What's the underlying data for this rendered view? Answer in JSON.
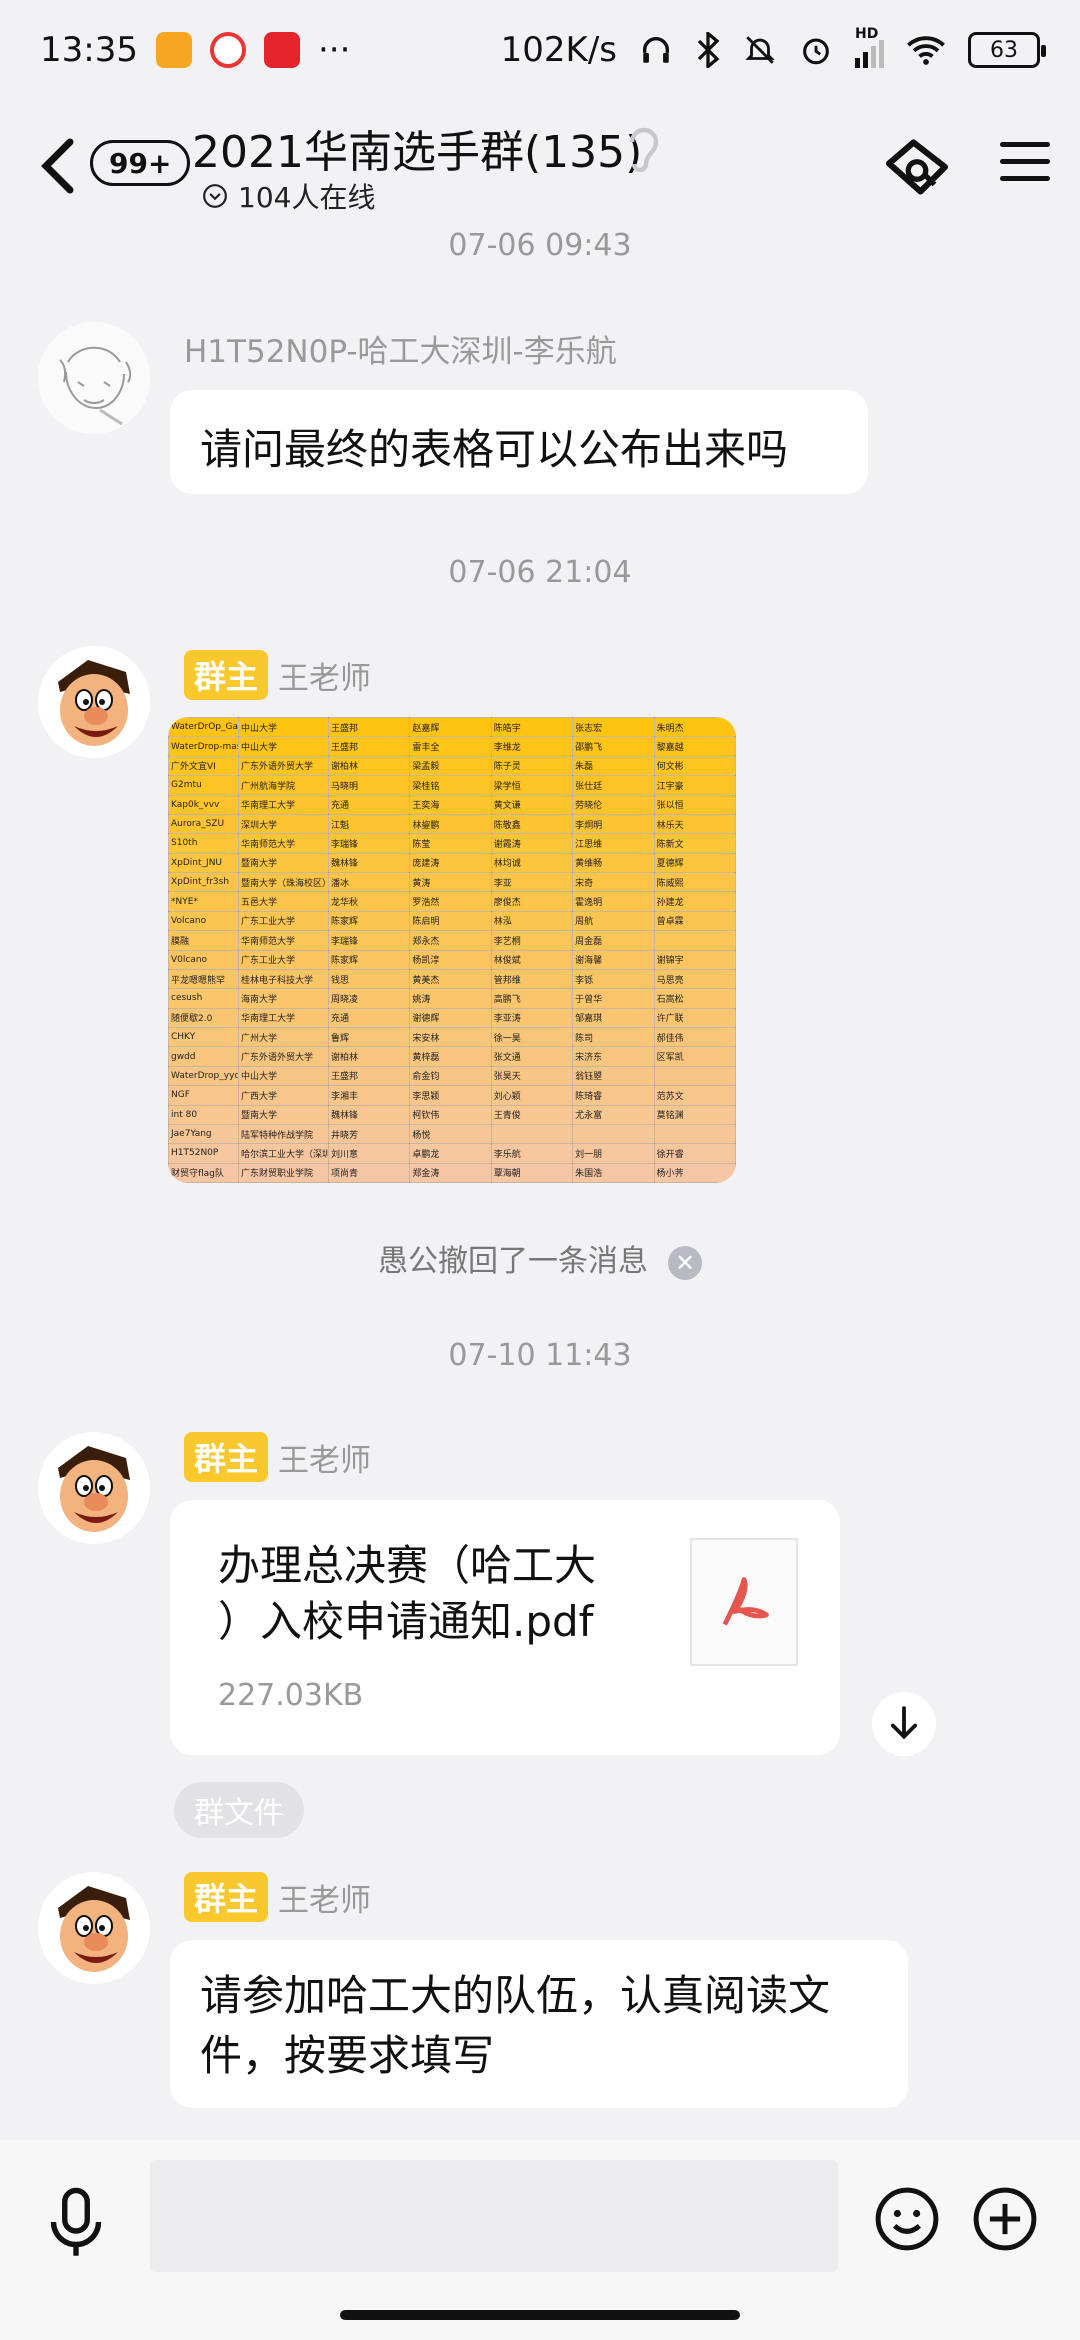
{
  "status_bar": {
    "time": "13:35",
    "more": "···",
    "net_speed": "102K/s",
    "signal_label": "HD",
    "battery": "63"
  },
  "header": {
    "unread_badge": "99+",
    "title": "2021华南选手群(135)",
    "online": "104人在线"
  },
  "messages": [
    {
      "type": "timestamp",
      "text": "07-06 09:43"
    },
    {
      "type": "text",
      "sender": "H1T52N0P-哈工大深圳-李乐航",
      "text": "请问最终的表格可以公布出来吗"
    },
    {
      "type": "timestamp",
      "text": "07-06 21:04"
    },
    {
      "type": "image",
      "sender": "王老师",
      "owner_tag": "群主"
    },
    {
      "type": "recall",
      "text": "愚公撤回了一条消息"
    },
    {
      "type": "timestamp",
      "text": "07-10 11:43"
    },
    {
      "type": "file",
      "sender": "王老师",
      "owner_tag": "群主",
      "file_name": "办理总决赛（哈工大）入校申请通知.pdf",
      "file_name_line1": "办理总决赛（哈工大",
      "file_name_line2": "）入校申请通知.pdf",
      "file_size": "227.03KB",
      "chip": "群文件"
    },
    {
      "type": "text",
      "sender": "王老师",
      "owner_tag": "群主",
      "text": "请参加哈工大的队伍，认真阅读文件，按要求填写",
      "line1": "请参加哈工大的队伍，认真阅读文",
      "line2": "件，按要求填写"
    }
  ],
  "shared_table": [
    [
      "WaterDrOp_Gaming",
      "中山大学",
      "王盛邦",
      "赵嘉辉",
      "陈皓宇",
      "张志宏",
      "朱明杰"
    ],
    [
      "WaterDrop-master",
      "中山大学",
      "王盛邦",
      "雷丰全",
      "李维龙",
      "邵鹏飞",
      "黎嘉越"
    ],
    [
      "广外文宜VI",
      "广东外语外贸大学",
      "谢柏林",
      "梁孟毅",
      "陈子灵",
      "朱磊",
      "何文彬"
    ],
    [
      "G2mtu",
      "广州航海学院",
      "马晓明",
      "梁桂铭",
      "梁学恒",
      "张仕廷",
      "江宇豪"
    ],
    [
      "Kap0k_vvv",
      "华南理工大学",
      "充通",
      "王奕海",
      "黄文谦",
      "劳晓伦",
      "张以恒"
    ],
    [
      "Aurora_SZU",
      "深圳大学",
      "江魁",
      "林鋆鹏",
      "陈敬鑫",
      "李炯明",
      "林乐天"
    ],
    [
      "S10th",
      "华南师范大学",
      "李瑞锋",
      "陈莹",
      "谢霞涛",
      "江思维",
      "陈新文"
    ],
    [
      "XpDint_JNU",
      "暨南大学",
      "魏林锋",
      "庞建涛",
      "林均诚",
      "黄维畅",
      "夏德辉"
    ],
    [
      "XpDint_fr3sh",
      "暨南大学（珠海校区）",
      "潘冰",
      "黄涛",
      "李亚",
      "宋奇",
      "陈威熙"
    ],
    [
      "*NYE*",
      "五邑大学",
      "龙华秋",
      "罗浩然",
      "廖俊杰",
      "霍逸明",
      "孙建龙"
    ],
    [
      "Volcano",
      "广东工业大学",
      "陈家辉",
      "陈启明",
      "林泓",
      "周航",
      "曾卓霖"
    ],
    [
      "膜融",
      "华南师范大学",
      "李瑞锋",
      "郑永杰",
      "李艺桐",
      "周金磊",
      ""
    ],
    [
      "V0lcano",
      "广东工业大学",
      "陈家辉",
      "杨凯淳",
      "林俊斌",
      "谢海馨",
      "谢锦宇"
    ],
    [
      "平龙嗯嗯熊罕",
      "桂林电子科技大学",
      "钱思",
      "黄美杰",
      "管邦维",
      "李铄",
      "马思亮"
    ],
    [
      "cesush",
      "海南大学",
      "周晓凌",
      "姚涛",
      "高鹏飞",
      "于曾华",
      "石嵩松"
    ],
    [
      "随便歇2.0",
      "华南理工大学",
      "充通",
      "谢德辉",
      "李亚涛",
      "邹嘉琪",
      "许广联"
    ],
    [
      "CHKY",
      "广州大学",
      "鲁辉",
      "宋安林",
      "徐一昊",
      "陈司",
      "郝佳伟"
    ],
    [
      "gwdd",
      "广东外语外贸大学",
      "谢柏林",
      "黄梓磊",
      "张文通",
      "宋济东",
      "区军凯"
    ],
    [
      "WaterDrop_yyds",
      "中山大学",
      "王盛邦",
      "俞金钧",
      "张昊天",
      "翁钰曌",
      ""
    ],
    [
      "NGF",
      "广西大学",
      "李湘丰",
      "李思颖",
      "刘心颖",
      "陈琦睿",
      "范苏文"
    ],
    [
      "int 80",
      "暨南大学",
      "魏林锋",
      "柯钦伟",
      "王青俊",
      "尤永富",
      "莫铭渊"
    ],
    [
      "Jae7Yang",
      "陆军特种作战学院",
      "井晓芳",
      "杨悦",
      "",
      "",
      ""
    ],
    [
      "H1T52N0P",
      "哈尔滨工业大学（深圳）",
      "刘川意",
      "卓鹏龙",
      "李乐航",
      "刘一朋",
      "徐开睿"
    ],
    [
      "财贸守flag队",
      "广东财贸职业学院",
      "项尚青",
      "郑金涛",
      "覃海朝",
      "朱国浩",
      "杨小荠"
    ]
  ],
  "input_bar": {
    "placeholder": ""
  },
  "colors": {
    "owner_tag": "#f9c82d",
    "background": "#f2f2f5",
    "pdf_red": "#e6564e"
  }
}
